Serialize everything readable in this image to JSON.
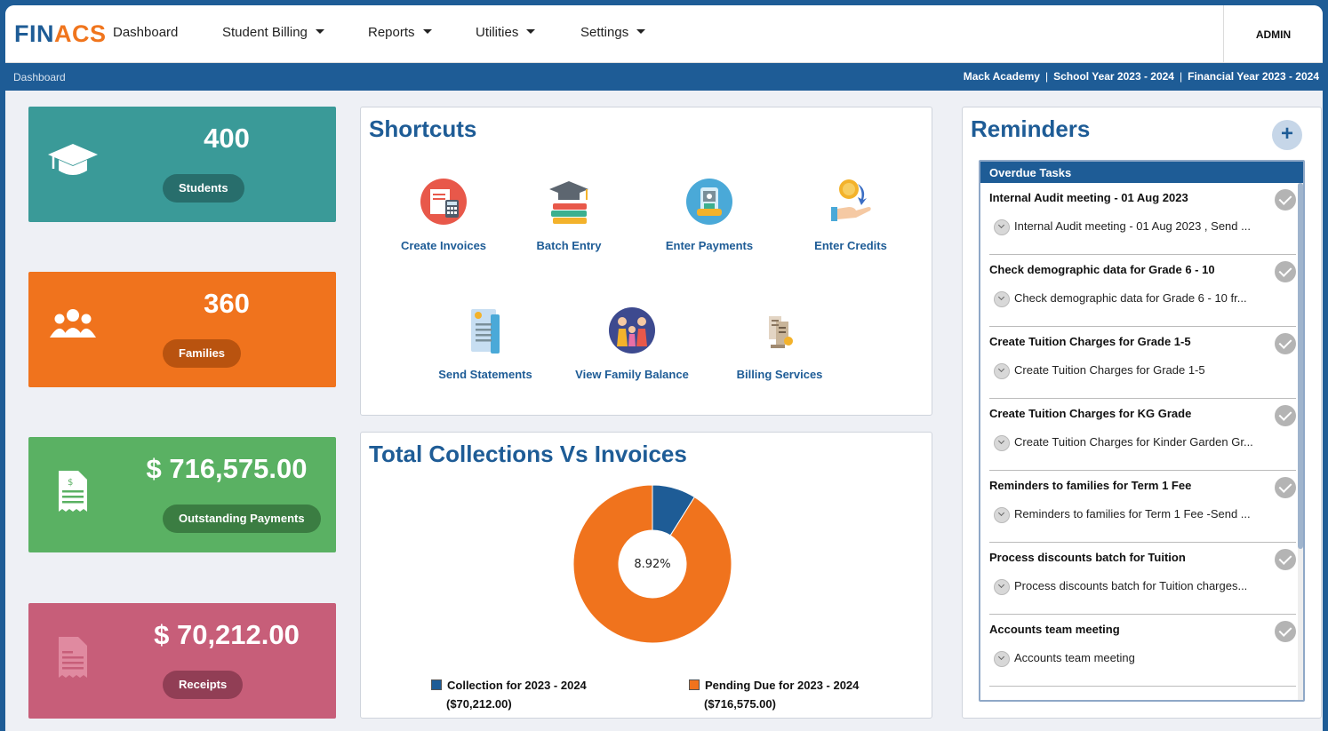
{
  "brand": {
    "part1": "FIN",
    "part2": "ACS",
    "color_primary": "#1e5c96",
    "color_accent": "#f0751d"
  },
  "nav": {
    "dashboard": "Dashboard",
    "student_billing": "Student Billing",
    "reports": "Reports",
    "utilities": "Utilities",
    "settings": "Settings",
    "user": "ADMIN"
  },
  "subbar": {
    "breadcrumb": "Dashboard",
    "school": "Mack Academy",
    "school_year": "School Year 2023 - 2024",
    "financial_year": "Financial Year 2023 - 2024",
    "separator": "|"
  },
  "stats": [
    {
      "value": "400",
      "label": "Students",
      "icon": "graduation-cap-icon",
      "color": "#3a9a98"
    },
    {
      "value": "360",
      "label": "Families",
      "icon": "users-icon",
      "color": "#f0731d"
    },
    {
      "value": "$ 716,575.00",
      "label": "Outstanding Payments",
      "icon": "invoice-icon",
      "color": "#5ab163"
    },
    {
      "value": "$ 70,212.00",
      "label": "Receipts",
      "icon": "receipt-icon",
      "color": "#c75e79"
    }
  ],
  "shortcuts": {
    "title": "Shortcuts",
    "items": [
      {
        "label": "Create Invoices",
        "icon": "create-invoices-icon"
      },
      {
        "label": "Batch Entry",
        "icon": "batch-entry-icon"
      },
      {
        "label": "Enter Payments",
        "icon": "enter-payments-icon"
      },
      {
        "label": "Enter Credits",
        "icon": "enter-credits-icon"
      },
      {
        "label": "Send Statements",
        "icon": "send-statements-icon"
      },
      {
        "label": "View Family Balance",
        "icon": "family-balance-icon"
      },
      {
        "label": "Billing Services",
        "icon": "billing-services-icon"
      }
    ]
  },
  "collections": {
    "title": "Total Collections Vs Invoices"
  },
  "chart_data": {
    "type": "pie",
    "title": "Total Collections Vs Invoices",
    "center_label": "8.92%",
    "categories": [
      "Collection for 2023 - 2024",
      "Pending Due for 2023 - 2024"
    ],
    "values": [
      70212.0,
      716575.0
    ],
    "amount_labels": [
      "($70,212.00)",
      "($716,575.00)"
    ],
    "colors": [
      "#1e5c96",
      "#f0731d"
    ],
    "donut": true,
    "legend_position": "bottom"
  },
  "reminders": {
    "title": "Reminders",
    "add": "+",
    "section": "Overdue Tasks",
    "tasks": [
      {
        "title": "Internal Audit meeting - 01 Aug 2023",
        "detail": "Internal Audit meeting - 01 Aug 2023 , Send ..."
      },
      {
        "title": "Check demographic data for Grade 6 - 10",
        "detail": "Check demographic data for Grade 6 - 10 fr..."
      },
      {
        "title": "Create Tuition Charges for Grade 1-5",
        "detail": "Create Tuition Charges for Grade 1-5"
      },
      {
        "title": "Create Tuition Charges for KG Grade",
        "detail": "Create Tuition Charges for Kinder Garden Gr..."
      },
      {
        "title": "Reminders to families for Term 1 Fee",
        "detail": "Reminders to families for Term 1 Fee -Send ..."
      },
      {
        "title": "Process discounts batch for Tuition",
        "detail": "Process discounts batch for Tuition charges..."
      },
      {
        "title": "Accounts team meeting",
        "detail": "Accounts team meeting"
      }
    ]
  }
}
